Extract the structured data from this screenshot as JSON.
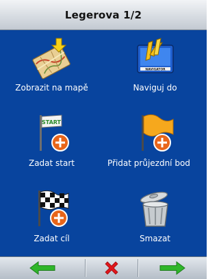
{
  "header": {
    "title": "Legerova 1/2"
  },
  "menu": {
    "items": [
      {
        "label": "Zobrazit na mapě",
        "icon": "map-with-arrow-icon"
      },
      {
        "label": "Naviguj do",
        "icon": "navigator-icon"
      },
      {
        "label": "Zadat start",
        "icon": "start-flag-icon"
      },
      {
        "label": "Přidat průjezdní bod",
        "icon": "waypoint-flag-icon"
      },
      {
        "label": "Zadat cíl",
        "icon": "checkered-flag-icon"
      },
      {
        "label": "Smazat",
        "icon": "trash-can-icon"
      }
    ]
  },
  "toolbar": {
    "back": {
      "icon": "arrow-left-icon",
      "color": "#2fb62a"
    },
    "cancel": {
      "icon": "close-icon",
      "color": "#e0161b"
    },
    "next": {
      "icon": "arrow-right-icon",
      "color": "#2fb62a"
    }
  },
  "colors": {
    "background": "#08449e",
    "label_text": "#ffffff"
  }
}
